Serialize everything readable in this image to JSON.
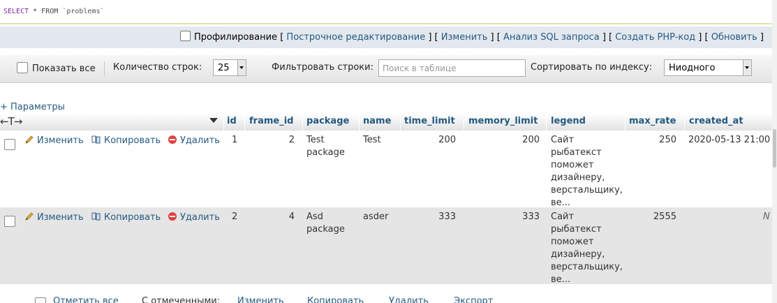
{
  "sql": {
    "keyword1": "SELECT",
    "middle": " * FROM ",
    "table": "`problems`"
  },
  "options_bar": {
    "profiling_label": "Профилирование",
    "open_bracket": "[",
    "close_bracket": "]",
    "sep": "] [",
    "inline_edit": "Построчное редактирование",
    "edit": "Изменить",
    "analyze_sql": "Анализ SQL запроса",
    "create_php": "Создать PHP-код",
    "refresh": "Обновить"
  },
  "nav": {
    "show_all": "Показать все",
    "row_count_label": "Количество строк:",
    "row_count_value": "25",
    "filter_label": "Фильтровать строки:",
    "filter_placeholder": "Поиск в таблице",
    "sort_label": "Сортировать по индексу:",
    "sort_value": "Ниодного"
  },
  "params_label": "+ Параметры",
  "arrows": "←T→",
  "columns": [
    "id",
    "frame_id",
    "package",
    "name",
    "time_limit",
    "memory_limit",
    "legend",
    "max_rate",
    "created_at"
  ],
  "actions": {
    "edit": "Изменить",
    "copy": "Копировать",
    "delete": "Удалить"
  },
  "rows": [
    {
      "id": "1",
      "frame_id": "2",
      "package": [
        "Test",
        "package"
      ],
      "name": "Test",
      "time_limit": "200",
      "memory_limit": "200",
      "legend": [
        "Сайт",
        "рыбатекст",
        "поможет",
        "дизайнеру,",
        "верстальщику,",
        "ве..."
      ],
      "max_rate": "250",
      "created_at": "2020-05-13 21:00"
    },
    {
      "id": "2",
      "frame_id": "4",
      "package": [
        "Asd",
        "package"
      ],
      "name": "asder",
      "time_limit": "333",
      "memory_limit": "333",
      "legend": [
        "Сайт",
        "рыбатекст",
        "поможет",
        "дизайнеру,",
        "верстальщику,",
        "ве..."
      ],
      "max_rate": "2555",
      "created_at": "N"
    }
  ],
  "footer": {
    "check_all": "Отметить все",
    "with_selected": "С отмеченными:",
    "edit": "Изменить",
    "copy": "Копировать",
    "delete": "Удалить",
    "export": "Экспорт"
  },
  "colors": {
    "link": "#235a81",
    "row_even": "#e5e5e5",
    "options_bar": "#e3e8ef"
  }
}
